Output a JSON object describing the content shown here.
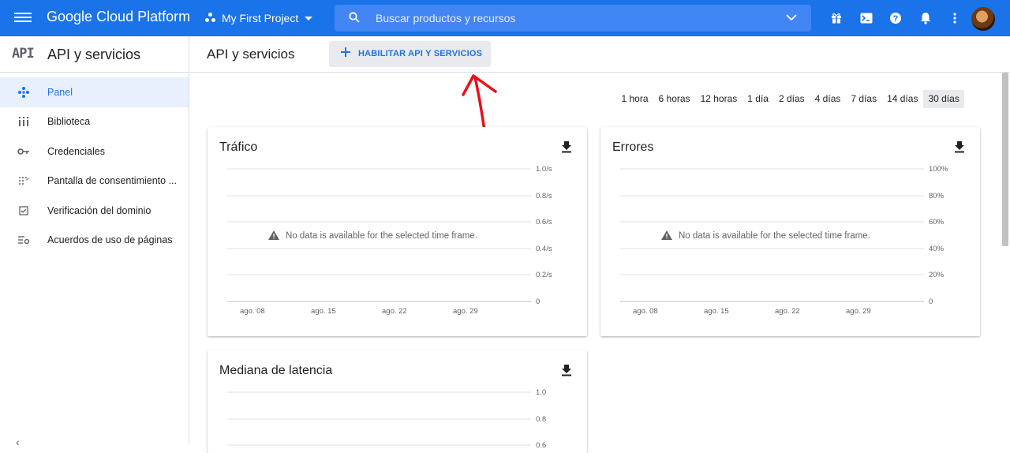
{
  "topbar": {
    "brand": "Google Cloud Platform",
    "project": "My First Project",
    "search_placeholder": "Buscar productos y recursos",
    "icons": [
      "gift-icon",
      "cloud-shell-icon",
      "help-icon",
      "notifications-icon",
      "more-vert-icon"
    ],
    "color": "#1a73e8"
  },
  "sidebar": {
    "logo": "API",
    "title": "API y servicios",
    "items": [
      {
        "label": "Panel",
        "icon": "dashboard-icon",
        "active": true
      },
      {
        "label": "Biblioteca",
        "icon": "library-icon",
        "active": false
      },
      {
        "label": "Credenciales",
        "icon": "key-icon",
        "active": false
      },
      {
        "label": "Pantalla de consentimiento ...",
        "icon": "consent-icon",
        "active": false
      },
      {
        "label": "Verificación del dominio",
        "icon": "verify-icon",
        "active": false
      },
      {
        "label": "Acuerdos de uso de páginas",
        "icon": "settings-list-icon",
        "active": false
      }
    ],
    "collapse_label": "‹"
  },
  "main": {
    "title": "API y servicios",
    "enable_button": "HABILITAR API Y SERVICIOS",
    "ranges": [
      "1 hora",
      "6 horas",
      "12 horas",
      "1 día",
      "2 días",
      "4 días",
      "7 días",
      "14 días",
      "30 días"
    ],
    "selected_range": "30 días"
  },
  "cards": {
    "traffic": {
      "title": "Tráfico",
      "nodata": "No data is available for the selected time frame.",
      "yticks": [
        "1.0/s",
        "0.8/s",
        "0.6/s",
        "0.4/s",
        "0.2/s",
        "0"
      ],
      "xticks": [
        "ago. 08",
        "ago. 15",
        "ago. 22",
        "ago. 29"
      ]
    },
    "errors": {
      "title": "Errores",
      "nodata": "No data is available for the selected time frame.",
      "yticks": [
        "100%",
        "80%",
        "60%",
        "40%",
        "20%",
        "0"
      ],
      "xticks": [
        "ago. 08",
        "ago. 15",
        "ago. 22",
        "ago. 29"
      ]
    },
    "latency": {
      "title": "Mediana de latencia",
      "yticks": [
        "1.0",
        "0.8",
        "0.6"
      ]
    }
  },
  "annotation": {
    "color": "#e8101a"
  }
}
